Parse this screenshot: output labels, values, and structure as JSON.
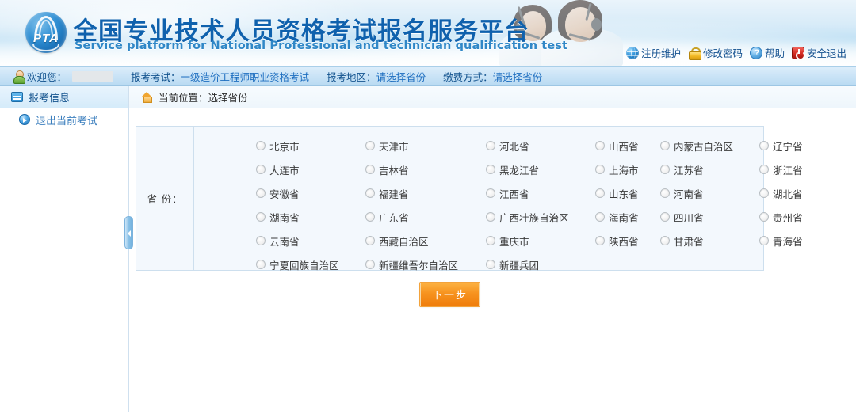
{
  "header": {
    "logo_text": "PTA",
    "title": "全国专业技术人员资格考试报名服务平台",
    "subtitle": "Service platform for National Professional and technician qualification test",
    "links": [
      {
        "label": "注册维护",
        "icon": "globe-icon"
      },
      {
        "label": "修改密码",
        "icon": "lock-icon"
      },
      {
        "label": "帮助",
        "icon": "help-icon"
      },
      {
        "label": "安全退出",
        "icon": "power-icon"
      }
    ]
  },
  "welcome_bar": {
    "greeting": "欢迎您：",
    "user_name": "",
    "exam_label": "报考考试：",
    "exam_value": "一级造价工程师职业资格考试",
    "region_label": "报考地区：",
    "region_value": "请选择省份",
    "payment_label": "缴费方式：",
    "payment_value": "请选择省份"
  },
  "sidebar": {
    "items": [
      {
        "label": "报考信息",
        "icon": "document-icon",
        "type": "primary"
      },
      {
        "label": "退出当前考试",
        "icon": "arrow-right-icon",
        "type": "sub"
      }
    ]
  },
  "breadcrumb": {
    "icon": "home-icon",
    "text": "当前位置：选择省份"
  },
  "form": {
    "province_label": "省 份：",
    "rows": [
      [
        {
          "label": "北京市",
          "selected": false
        },
        {
          "label": "天津市",
          "selected": false
        },
        {
          "label": "河北省",
          "selected": false
        },
        {
          "label": "山西省",
          "selected": false
        },
        {
          "label": "内蒙古自治区",
          "selected": false
        },
        {
          "label": "辽宁省",
          "selected": false
        }
      ],
      [
        {
          "label": "大连市",
          "selected": false
        },
        {
          "label": "吉林省",
          "selected": false
        },
        {
          "label": "黑龙江省",
          "selected": false
        },
        {
          "label": "上海市",
          "selected": false
        },
        {
          "label": "江苏省",
          "selected": false
        },
        {
          "label": "浙江省",
          "selected": false
        }
      ],
      [
        {
          "label": "安徽省",
          "selected": false
        },
        {
          "label": "福建省",
          "selected": false
        },
        {
          "label": "江西省",
          "selected": false
        },
        {
          "label": "山东省",
          "selected": false
        },
        {
          "label": "河南省",
          "selected": false
        },
        {
          "label": "湖北省",
          "selected": false
        }
      ],
      [
        {
          "label": "湖南省",
          "selected": false
        },
        {
          "label": "广东省",
          "selected": false
        },
        {
          "label": "广西壮族自治区",
          "selected": false
        },
        {
          "label": "海南省",
          "selected": false
        },
        {
          "label": "四川省",
          "selected": false
        },
        {
          "label": "贵州省",
          "selected": false
        }
      ],
      [
        {
          "label": "云南省",
          "selected": false
        },
        {
          "label": "西藏自治区",
          "selected": false
        },
        {
          "label": "重庆市",
          "selected": false
        },
        {
          "label": "陕西省",
          "selected": false
        },
        {
          "label": "甘肃省",
          "selected": false
        },
        {
          "label": "青海省",
          "selected": false
        }
      ],
      [
        {
          "label": "宁夏回族自治区",
          "selected": false
        },
        {
          "label": "新疆维吾尔自治区",
          "selected": false
        },
        {
          "label": "新疆兵团",
          "selected": false
        }
      ]
    ],
    "column_offsets": [
      78,
      216,
      368,
      506,
      588,
      713
    ],
    "next_button": "下一步"
  },
  "colors": {
    "brand_blue": "#0f61ad",
    "subtitle_blue": "#2f87c7",
    "link_blue": "#13508f",
    "panel_bg": "#f3f8fd",
    "panel_border": "#cddfee",
    "button_orange": "#f79420"
  }
}
